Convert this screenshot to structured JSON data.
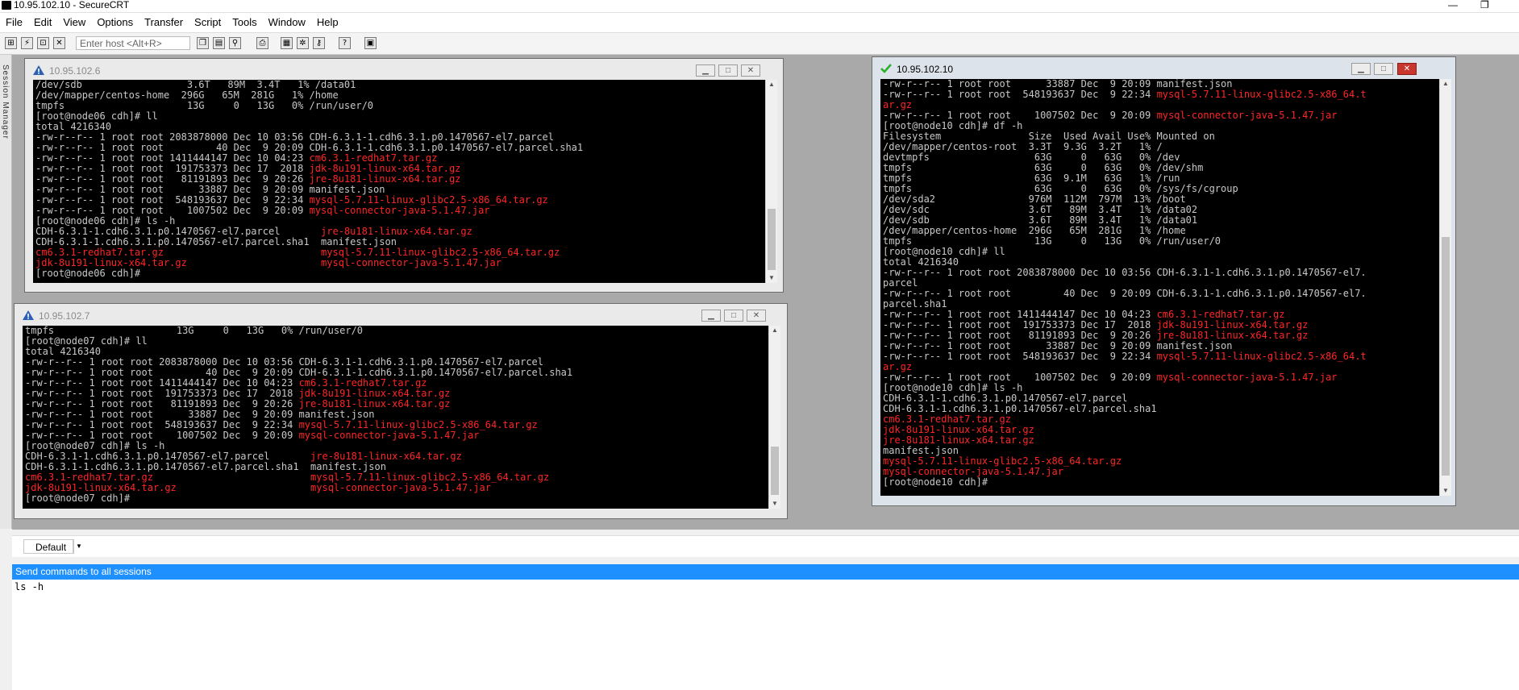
{
  "app": {
    "title": "10.95.102.10 - SecureCRT",
    "minimize_glyph": "—",
    "maximize_glyph": "❐"
  },
  "menu": [
    "File",
    "Edit",
    "View",
    "Options",
    "Transfer",
    "Script",
    "Tools",
    "Window",
    "Help"
  ],
  "toolbar": {
    "icons": [
      "connect-icon",
      "quick-connect-icon",
      "connect-tab-icon",
      "disconnect-icon",
      "copy-icon",
      "paste-icon",
      "find-icon",
      "print-icon",
      "session-options-icon",
      "global-options-icon",
      "keymap-icon",
      "help-icon",
      "sftp-icon"
    ],
    "host_placeholder": "Enter host <Alt+R>"
  },
  "session_manager_label": "Session Manager",
  "sessions": [
    {
      "title": "10.95.102.6",
      "status": "warning",
      "lines": [
        [
          {
            "t": "/dev/sdb                  3.6T   89M  3.4T   1% /data01"
          }
        ],
        [
          {
            "t": "/dev/mapper/centos-home  296G   65M  281G   1% /home"
          }
        ],
        [
          {
            "t": "tmpfs                     13G     0   13G   0% /run/user/0"
          }
        ],
        [
          {
            "t": "[root@node06 cdh]# ll"
          }
        ],
        [
          {
            "t": "total 4216340"
          }
        ],
        [
          {
            "t": "-rw-r--r-- 1 root root 2083878000 Dec 10 03:56 CDH-6.3.1-1.cdh6.3.1.p0.1470567-el7.parcel"
          }
        ],
        [
          {
            "t": "-rw-r--r-- 1 root root         40 Dec  9 20:09 CDH-6.3.1-1.cdh6.3.1.p0.1470567-el7.parcel.sha1"
          }
        ],
        [
          {
            "t": "-rw-r--r-- 1 root root 1411444147 Dec 10 04:23 "
          },
          {
            "t": "cm6.3.1-redhat7.tar.gz",
            "c": "red"
          }
        ],
        [
          {
            "t": "-rw-r--r-- 1 root root  191753373 Dec 17  2018 "
          },
          {
            "t": "jdk-8u191-linux-x64.tar.gz",
            "c": "red"
          }
        ],
        [
          {
            "t": "-rw-r--r-- 1 root root   81191893 Dec  9 20:26 "
          },
          {
            "t": "jre-8u181-linux-x64.tar.gz",
            "c": "red"
          }
        ],
        [
          {
            "t": "-rw-r--r-- 1 root root      33887 Dec  9 20:09 manifest.json"
          }
        ],
        [
          {
            "t": "-rw-r--r-- 1 root root  548193637 Dec  9 22:34 "
          },
          {
            "t": "mysql-5.7.11-linux-glibc2.5-x86_64.tar.gz",
            "c": "red"
          }
        ],
        [
          {
            "t": "-rw-r--r-- 1 root root    1007502 Dec  9 20:09 "
          },
          {
            "t": "mysql-connector-java-5.1.47.jar",
            "c": "red"
          }
        ],
        [
          {
            "t": "[root@node06 cdh]# ls -h"
          }
        ],
        [
          {
            "t": "CDH-6.3.1-1.cdh6.3.1.p0.1470567-el7.parcel       "
          },
          {
            "t": "jre-8u181-linux-x64.tar.gz",
            "c": "red"
          }
        ],
        [
          {
            "t": "CDH-6.3.1-1.cdh6.3.1.p0.1470567-el7.parcel.sha1  manifest.json"
          }
        ],
        [
          {
            "t": "cm6.3.1-redhat7.tar.gz",
            "c": "red"
          },
          {
            "t": "                           "
          },
          {
            "t": "mysql-5.7.11-linux-glibc2.5-x86_64.tar.gz",
            "c": "red"
          }
        ],
        [
          {
            "t": "jdk-8u191-linux-x64.tar.gz",
            "c": "red"
          },
          {
            "t": "                       "
          },
          {
            "t": "mysql-connector-java-5.1.47.jar",
            "c": "red"
          }
        ],
        [
          {
            "t": "[root@node06 cdh]#"
          }
        ]
      ]
    },
    {
      "title": "10.95.102.7",
      "status": "warning",
      "lines": [
        [
          {
            "t": "tmpfs                     13G     0   13G   0% /run/user/0"
          }
        ],
        [
          {
            "t": "[root@node07 cdh]# ll"
          }
        ],
        [
          {
            "t": "total 4216340"
          }
        ],
        [
          {
            "t": "-rw-r--r-- 1 root root 2083878000 Dec 10 03:56 CDH-6.3.1-1.cdh6.3.1.p0.1470567-el7.parcel"
          }
        ],
        [
          {
            "t": "-rw-r--r-- 1 root root         40 Dec  9 20:09 CDH-6.3.1-1.cdh6.3.1.p0.1470567-el7.parcel.sha1"
          }
        ],
        [
          {
            "t": "-rw-r--r-- 1 root root 1411444147 Dec 10 04:23 "
          },
          {
            "t": "cm6.3.1-redhat7.tar.gz",
            "c": "red"
          }
        ],
        [
          {
            "t": "-rw-r--r-- 1 root root  191753373 Dec 17  2018 "
          },
          {
            "t": "jdk-8u191-linux-x64.tar.gz",
            "c": "red"
          }
        ],
        [
          {
            "t": "-rw-r--r-- 1 root root   81191893 Dec  9 20:26 "
          },
          {
            "t": "jre-8u181-linux-x64.tar.gz",
            "c": "red"
          }
        ],
        [
          {
            "t": "-rw-r--r-- 1 root root      33887 Dec  9 20:09 manifest.json"
          }
        ],
        [
          {
            "t": "-rw-r--r-- 1 root root  548193637 Dec  9 22:34 "
          },
          {
            "t": "mysql-5.7.11-linux-glibc2.5-x86_64.tar.gz",
            "c": "red"
          }
        ],
        [
          {
            "t": "-rw-r--r-- 1 root root    1007502 Dec  9 20:09 "
          },
          {
            "t": "mysql-connector-java-5.1.47.jar",
            "c": "red"
          }
        ],
        [
          {
            "t": "[root@node07 cdh]# ls -h"
          }
        ],
        [
          {
            "t": "CDH-6.3.1-1.cdh6.3.1.p0.1470567-el7.parcel       "
          },
          {
            "t": "jre-8u181-linux-x64.tar.gz",
            "c": "red"
          }
        ],
        [
          {
            "t": "CDH-6.3.1-1.cdh6.3.1.p0.1470567-el7.parcel.sha1  manifest.json"
          }
        ],
        [
          {
            "t": "cm6.3.1-redhat7.tar.gz",
            "c": "red"
          },
          {
            "t": "                           "
          },
          {
            "t": "mysql-5.7.11-linux-glibc2.5-x86_64.tar.gz",
            "c": "red"
          }
        ],
        [
          {
            "t": "jdk-8u191-linux-x64.tar.gz",
            "c": "red"
          },
          {
            "t": "                       "
          },
          {
            "t": "mysql-connector-java-5.1.47.jar",
            "c": "red"
          }
        ],
        [
          {
            "t": "[root@node07 cdh]#"
          }
        ]
      ]
    },
    {
      "title": "10.95.102.10",
      "status": "connected",
      "lines": [
        [
          {
            "t": "-rw-r--r-- 1 root root      33887 Dec  9 20:09 manifest.json"
          }
        ],
        [
          {
            "t": "-rw-r--r-- 1 root root  548193637 Dec  9 22:34 "
          },
          {
            "t": "mysql-5.7.11-linux-glibc2.5-x86_64.t",
            "c": "red"
          }
        ],
        [
          {
            "t": "ar.gz",
            "c": "red"
          }
        ],
        [
          {
            "t": "-rw-r--r-- 1 root root    1007502 Dec  9 20:09 "
          },
          {
            "t": "mysql-connector-java-5.1.47.jar",
            "c": "red"
          }
        ],
        [
          {
            "t": "[root@node10 cdh]# df -h"
          }
        ],
        [
          {
            "t": "Filesystem               Size  Used Avail Use% Mounted on"
          }
        ],
        [
          {
            "t": "/dev/mapper/centos-root  3.3T  9.3G  3.2T   1% /"
          }
        ],
        [
          {
            "t": "devtmpfs                  63G     0   63G   0% /dev"
          }
        ],
        [
          {
            "t": "tmpfs                     63G     0   63G   0% /dev/shm"
          }
        ],
        [
          {
            "t": "tmpfs                     63G  9.1M   63G   1% /run"
          }
        ],
        [
          {
            "t": "tmpfs                     63G     0   63G   0% /sys/fs/cgroup"
          }
        ],
        [
          {
            "t": "/dev/sda2                976M  112M  797M  13% /boot"
          }
        ],
        [
          {
            "t": "/dev/sdc                 3.6T   89M  3.4T   1% /data02"
          }
        ],
        [
          {
            "t": "/dev/sdb                 3.6T   89M  3.4T   1% /data01"
          }
        ],
        [
          {
            "t": "/dev/mapper/centos-home  296G   65M  281G   1% /home"
          }
        ],
        [
          {
            "t": "tmpfs                     13G     0   13G   0% /run/user/0"
          }
        ],
        [
          {
            "t": "[root@node10 cdh]# ll"
          }
        ],
        [
          {
            "t": "total 4216340"
          }
        ],
        [
          {
            "t": "-rw-r--r-- 1 root root 2083878000 Dec 10 03:56 CDH-6.3.1-1.cdh6.3.1.p0.1470567-el7."
          }
        ],
        [
          {
            "t": "parcel"
          }
        ],
        [
          {
            "t": "-rw-r--r-- 1 root root         40 Dec  9 20:09 CDH-6.3.1-1.cdh6.3.1.p0.1470567-el7."
          }
        ],
        [
          {
            "t": "parcel.sha1"
          }
        ],
        [
          {
            "t": "-rw-r--r-- 1 root root 1411444147 Dec 10 04:23 "
          },
          {
            "t": "cm6.3.1-redhat7.tar.gz",
            "c": "red"
          }
        ],
        [
          {
            "t": "-rw-r--r-- 1 root root  191753373 Dec 17  2018 "
          },
          {
            "t": "jdk-8u191-linux-x64.tar.gz",
            "c": "red"
          }
        ],
        [
          {
            "t": "-rw-r--r-- 1 root root   81191893 Dec  9 20:26 "
          },
          {
            "t": "jre-8u181-linux-x64.tar.gz",
            "c": "red"
          }
        ],
        [
          {
            "t": "-rw-r--r-- 1 root root      33887 Dec  9 20:09 manifest.json"
          }
        ],
        [
          {
            "t": "-rw-r--r-- 1 root root  548193637 Dec  9 22:34 "
          },
          {
            "t": "mysql-5.7.11-linux-glibc2.5-x86_64.t",
            "c": "red"
          }
        ],
        [
          {
            "t": "ar.gz",
            "c": "red"
          }
        ],
        [
          {
            "t": "-rw-r--r-- 1 root root    1007502 Dec  9 20:09 "
          },
          {
            "t": "mysql-connector-java-5.1.47.jar",
            "c": "red"
          }
        ],
        [
          {
            "t": "[root@node10 cdh]# ls -h"
          }
        ],
        [
          {
            "t": "CDH-6.3.1-1.cdh6.3.1.p0.1470567-el7.parcel"
          }
        ],
        [
          {
            "t": "CDH-6.3.1-1.cdh6.3.1.p0.1470567-el7.parcel.sha1"
          }
        ],
        [
          {
            "t": "cm6.3.1-redhat7.tar.gz",
            "c": "red"
          }
        ],
        [
          {
            "t": "jdk-8u191-linux-x64.tar.gz",
            "c": "red"
          }
        ],
        [
          {
            "t": "jre-8u181-linux-x64.tar.gz",
            "c": "red"
          }
        ],
        [
          {
            "t": "manifest.json"
          }
        ],
        [
          {
            "t": "mysql-5.7.11-linux-glibc2.5-x86_64.tar.gz",
            "c": "red"
          }
        ],
        [
          {
            "t": "mysql-connector-java-5.1.47.jar",
            "c": "red"
          }
        ],
        [
          {
            "t": "[root@node10 cdh]#"
          }
        ]
      ]
    }
  ],
  "tab": {
    "label": "Default"
  },
  "command_window": {
    "header": "Send commands to all sessions",
    "text": "ls -h"
  },
  "colors": {
    "terminal_bg": "#000000",
    "terminal_fg": "#c8c8c8",
    "terminal_red": "#ff2525",
    "accent_blue": "#1e90ff",
    "warning_yellow": "#f5c000",
    "connected_green": "#2bb12b"
  }
}
